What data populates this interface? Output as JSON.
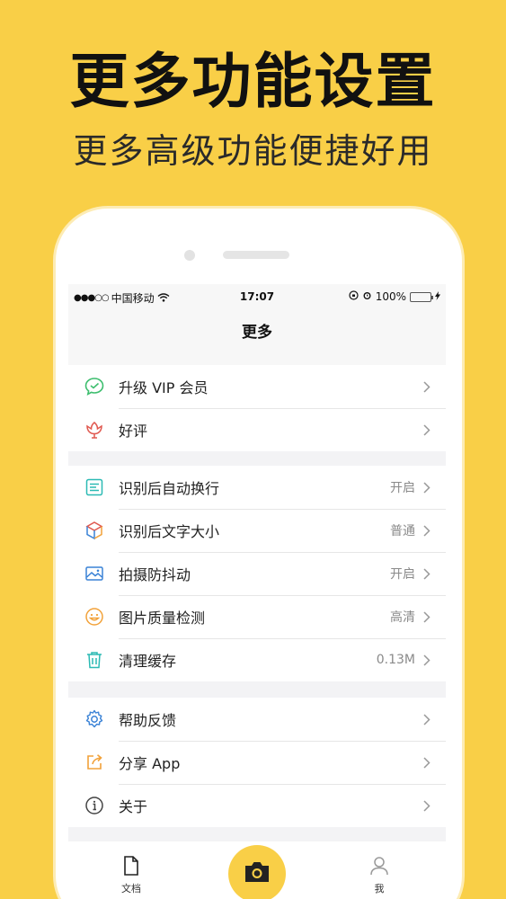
{
  "promo": {
    "title": "更多功能设置",
    "subtitle": "更多高级功能便捷好用"
  },
  "status_bar": {
    "carrier": "中国移动",
    "signal": "●●●○○",
    "time": "17:07",
    "battery": "100%"
  },
  "nav": {
    "title": "更多"
  },
  "groups": [
    {
      "items": [
        {
          "label": "升级 VIP 会员",
          "value": "",
          "icon": "vip-chat-icon"
        },
        {
          "label": "好评",
          "value": "",
          "icon": "flower-icon"
        }
      ]
    },
    {
      "items": [
        {
          "label": "识别后自动换行",
          "value": "开启",
          "icon": "text-wrap-icon"
        },
        {
          "label": "识别后文字大小",
          "value": "普通",
          "icon": "cube-icon"
        },
        {
          "label": "拍摄防抖动",
          "value": "开启",
          "icon": "image-icon"
        },
        {
          "label": "图片质量检测",
          "value": "高清",
          "icon": "smile-icon"
        },
        {
          "label": "清理缓存",
          "value": "0.13M",
          "icon": "trash-icon"
        }
      ]
    },
    {
      "items": [
        {
          "label": "帮助反馈",
          "value": "",
          "icon": "gear-icon"
        },
        {
          "label": "分享 App",
          "value": "",
          "icon": "share-icon"
        },
        {
          "label": "关于",
          "value": "",
          "icon": "info-icon"
        }
      ]
    }
  ],
  "tab_bar": {
    "documents_label": "文档",
    "me_label": "我"
  },
  "colors": {
    "background": "#F9CF47",
    "accent_green": "#3DBE6E",
    "accent_red": "#E0584F",
    "accent_blue": "#3A82D6",
    "accent_orange": "#F2A23A",
    "accent_teal": "#2BBAB4"
  }
}
